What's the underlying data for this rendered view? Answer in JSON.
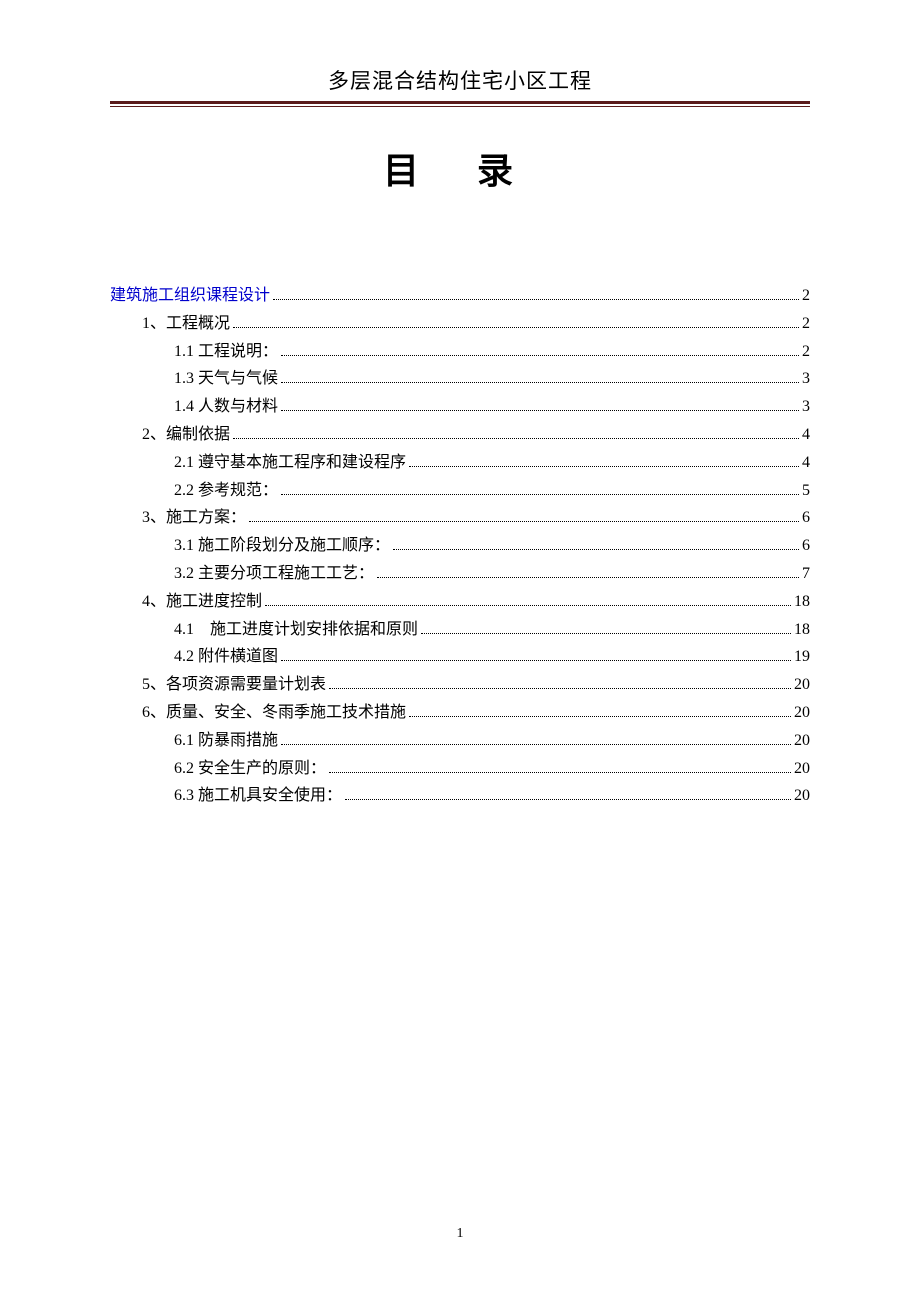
{
  "header": {
    "title": "多层混合结构住宅小区工程"
  },
  "toc_heading": "目 录",
  "toc": [
    {
      "label": "建筑施工组织课程设计",
      "page": "2",
      "indent": 0,
      "link": true
    },
    {
      "label": "1、工程概况",
      "page": "2",
      "indent": 1,
      "link": false
    },
    {
      "label": "1.1 工程说明：",
      "page": "2",
      "indent": 2,
      "link": false
    },
    {
      "label": "1.3 天气与气候",
      "page": "3",
      "indent": 2,
      "link": false
    },
    {
      "label": "1.4 人数与材料",
      "page": "3",
      "indent": 2,
      "link": false
    },
    {
      "label": "2、编制依据",
      "page": "4",
      "indent": 1,
      "link": false
    },
    {
      "label": "2.1 遵守基本施工程序和建设程序",
      "page": "4",
      "indent": 2,
      "link": false
    },
    {
      "label": "2.2 参考规范：",
      "page": "5",
      "indent": 2,
      "link": false
    },
    {
      "label": "3、施工方案：",
      "page": "6",
      "indent": 1,
      "link": false
    },
    {
      "label": "3.1 施工阶段划分及施工顺序：",
      "page": "6",
      "indent": 2,
      "link": false
    },
    {
      "label": "3.2 主要分项工程施工工艺：",
      "page": "7",
      "indent": 2,
      "link": false
    },
    {
      "label": "4、施工进度控制",
      "page": "18",
      "indent": 1,
      "link": false
    },
    {
      "label": "4.1　施工进度计划安排依据和原则",
      "page": "18",
      "indent": 2,
      "link": false
    },
    {
      "label": "4.2 附件横道图",
      "page": "19",
      "indent": 2,
      "link": false
    },
    {
      "label": "5、各项资源需要量计划表",
      "page": "20",
      "indent": 1,
      "link": false
    },
    {
      "label": "6、质量、安全、冬雨季施工技术措施",
      "page": "20",
      "indent": 1,
      "link": false
    },
    {
      "label": "6.1 防暴雨措施",
      "page": "20",
      "indent": 2,
      "link": false
    },
    {
      "label": "6.2 安全生产的原则：",
      "page": "20",
      "indent": 2,
      "link": false
    },
    {
      "label": "6.3 施工机具安全使用：",
      "page": "20",
      "indent": 2,
      "link": false
    }
  ],
  "footer": {
    "page_number": "1"
  }
}
